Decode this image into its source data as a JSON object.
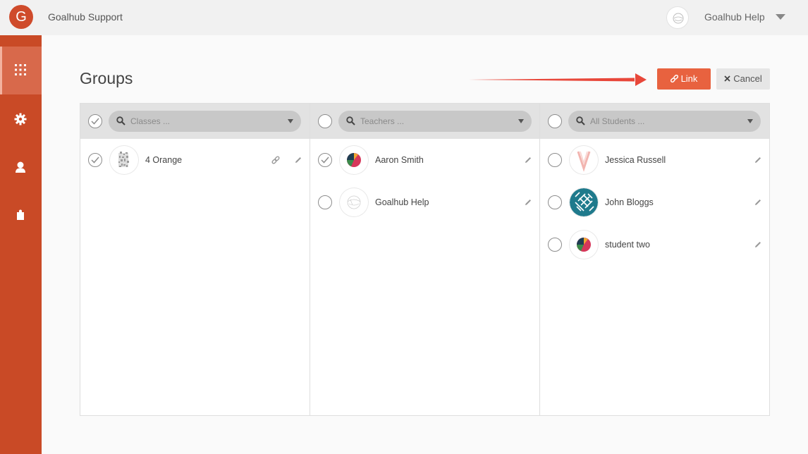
{
  "app": {
    "logo_letter": "G",
    "title": "Goalhub Support",
    "user_name": "Goalhub Help"
  },
  "sidebar": {
    "items": [
      {
        "icon": "grid-icon",
        "active": true
      },
      {
        "icon": "gear-icon",
        "active": false
      },
      {
        "icon": "user-icon",
        "active": false
      },
      {
        "icon": "puzzle-icon",
        "active": false
      }
    ]
  },
  "page": {
    "title": "Groups",
    "link_label": "Link",
    "cancel_label": "Cancel"
  },
  "colors": {
    "brand": "#c94a26",
    "link_button": "#e8623f",
    "arrow": "#e8473a"
  },
  "panels": [
    {
      "search_placeholder": "Classes ...",
      "items": [
        {
          "name": "4 Orange",
          "checked": true,
          "avatar": "noise",
          "icons": [
            "link-icon",
            "pencil-icon"
          ]
        }
      ]
    },
    {
      "search_placeholder": "Teachers ...",
      "items": [
        {
          "name": "Aaron Smith",
          "checked": true,
          "avatar": "triangles",
          "icons": [
            "pencil-icon"
          ]
        },
        {
          "name": "Goalhub Help",
          "checked": false,
          "avatar": "sketch",
          "icons": [
            "pencil-icon"
          ]
        }
      ]
    },
    {
      "search_placeholder": "All Students ...",
      "items": [
        {
          "name": "Jessica Russell",
          "checked": false,
          "avatar": "vee",
          "icons": [
            "pencil-icon"
          ]
        },
        {
          "name": "John Bloggs",
          "checked": false,
          "avatar": "maze",
          "icons": [
            "pencil-icon"
          ]
        },
        {
          "name": "student two",
          "checked": false,
          "avatar": "triangles",
          "icons": [
            "pencil-icon"
          ]
        }
      ]
    }
  ]
}
